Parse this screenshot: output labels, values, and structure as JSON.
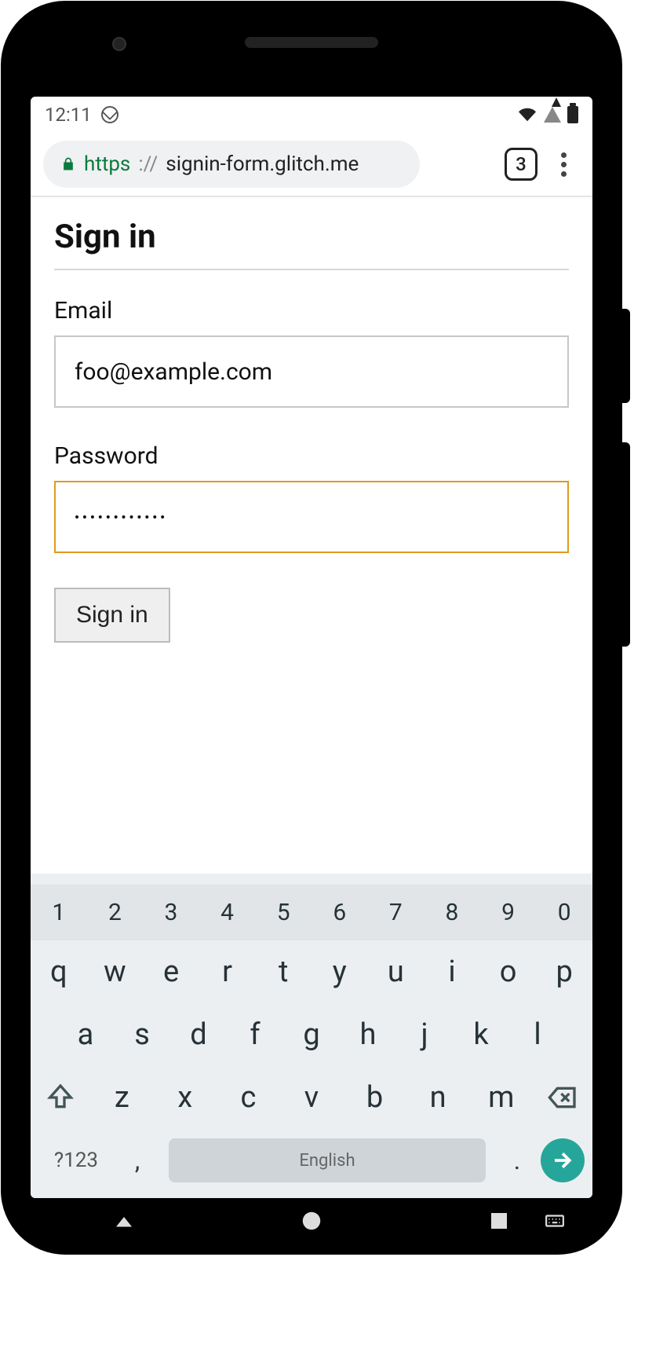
{
  "status": {
    "time": "12:11"
  },
  "browser": {
    "tab_count": "3",
    "url_scheme": "https",
    "url_sep": "://",
    "url_host": "signin-form.glitch.me"
  },
  "page": {
    "title": "Sign in",
    "email_label": "Email",
    "email_value": "foo@example.com",
    "password_label": "Password",
    "password_value": "••••••••••••",
    "submit_label": "Sign in"
  },
  "keyboard": {
    "numbers": [
      "1",
      "2",
      "3",
      "4",
      "5",
      "6",
      "7",
      "8",
      "9",
      "0"
    ],
    "row1": [
      "q",
      "w",
      "e",
      "r",
      "t",
      "y",
      "u",
      "i",
      "o",
      "p"
    ],
    "row2": [
      "a",
      "s",
      "d",
      "f",
      "g",
      "h",
      "j",
      "k",
      "l"
    ],
    "row3": [
      "z",
      "x",
      "c",
      "v",
      "b",
      "n",
      "m"
    ],
    "symbols_label": "?123",
    "space_label": "English",
    "comma": ",",
    "dot": "."
  }
}
